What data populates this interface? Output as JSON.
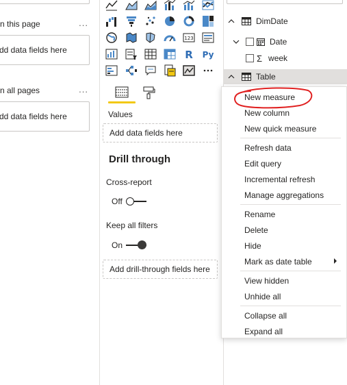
{
  "filters": {
    "page_section_label": "n this page",
    "page_drop_text": "dd data fields here",
    "all_section_label": "n all pages",
    "all_drop_text": "dd data fields here",
    "more_glyph": "..."
  },
  "visualizations": {
    "icons": [
      "line-chart-icon",
      "area-chart-icon",
      "stacked-area-chart-icon",
      "line-clustered-column-icon",
      "line-stacked-column-icon",
      "ribbon-chart-icon",
      "waterfall-chart-icon",
      "funnel-chart-icon",
      "scatter-chart-icon",
      "pie-chart-icon",
      "donut-chart-icon",
      "treemap-icon",
      "map-icon",
      "filled-map-icon",
      "shape-map-icon",
      "gauge-icon",
      "card-icon",
      "multi-row-card-icon",
      "kpi-icon",
      "slicer-icon",
      "table-visual-icon",
      "matrix-icon",
      "r-script-visual-icon",
      "python-visual-icon",
      "key-influencers-icon",
      "decomposition-tree-icon",
      "qa-visual-icon",
      "paginated-report-icon",
      "custom-visual-icon",
      "more-visuals-icon"
    ],
    "values_label": "Values",
    "values_well_text": "Add data fields here",
    "drill_heading": "Drill through",
    "cross_report_label": "Cross-report",
    "cross_report_state": "Off",
    "keep_filters_label": "Keep all filters",
    "keep_filters_state": "On",
    "drill_well_text": "Add drill-through fields here",
    "accent_color": "#f2c811"
  },
  "fields": {
    "tables": [
      {
        "name": "DimDate",
        "children": [
          {
            "name": "Date"
          },
          {
            "name": "week"
          }
        ]
      },
      {
        "name": "Table"
      }
    ]
  },
  "context_menu": {
    "groups": [
      [
        "New measure",
        "New column",
        "New quick measure"
      ],
      [
        "Refresh data",
        "Edit query",
        "Incremental refresh",
        "Manage aggregations"
      ],
      [
        "Rename",
        "Delete",
        "Hide",
        "Mark as date table"
      ],
      [
        "View hidden",
        "Unhide all"
      ],
      [
        "Collapse all",
        "Expand all"
      ]
    ],
    "submenu_item": "Mark as date table",
    "annotation_color": "#e02020"
  }
}
